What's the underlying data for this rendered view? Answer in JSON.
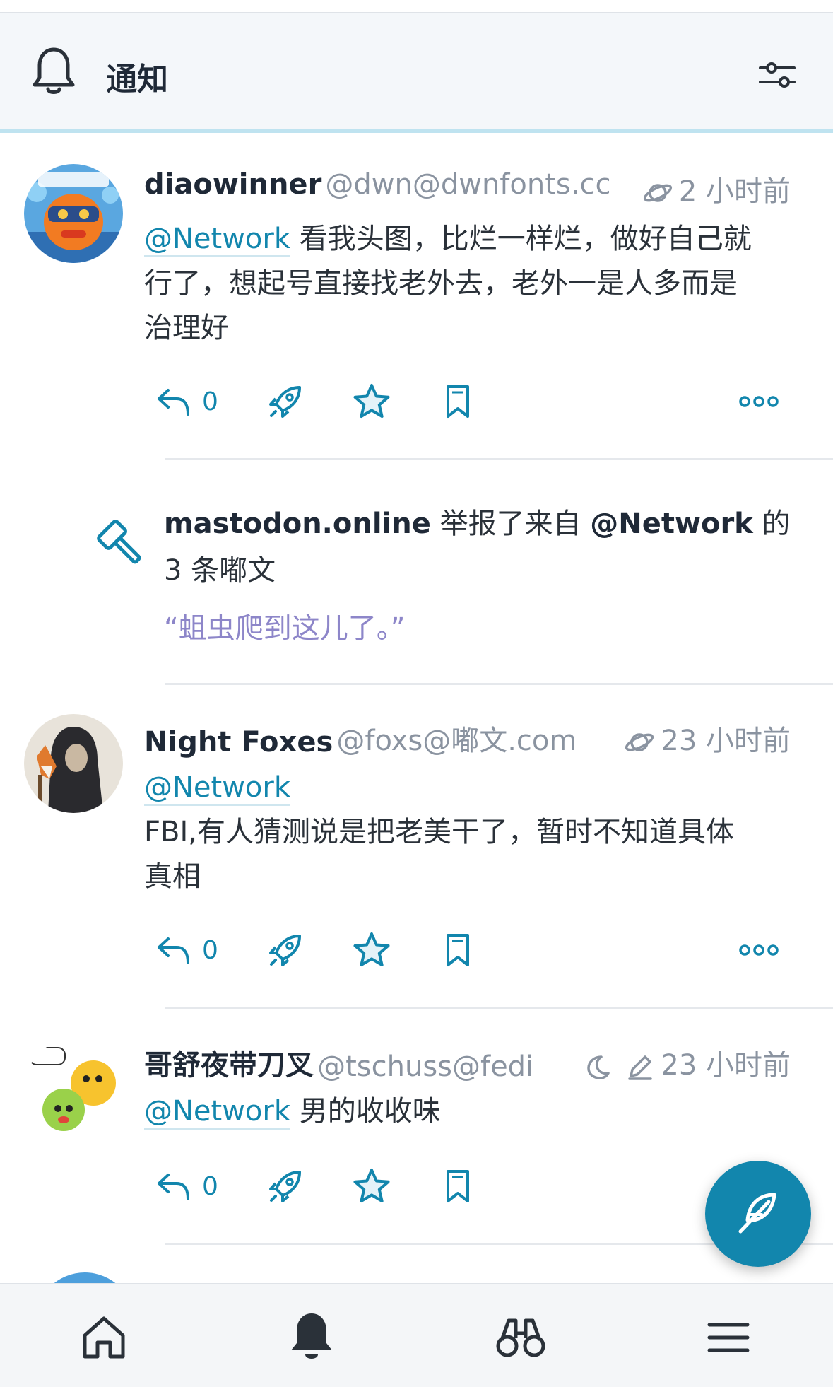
{
  "header": {
    "title": "通知"
  },
  "notifications": [
    {
      "name": "diaowinner",
      "handle": "@dwn@dwnfonts.cc",
      "time": "2 小时前",
      "mention": "@Network",
      "text_line1": "看我头图，比烂一样烂，做好自己就",
      "text_line2": "行了，想起号直接找老外去，老外一是人多而是",
      "text_line3": "治理好",
      "reply_count": "0",
      "visibility_icon": "planet-icon"
    },
    {
      "name": "Night Foxes",
      "handle": "@foxs@嘟文.com",
      "time": "23 小时前",
      "mention": "@Network",
      "text_line1": "FBI,有人猜测说是把老美干了，暂时不知道具体",
      "text_line2": "真相",
      "reply_count": "0",
      "visibility_icon": "planet-icon"
    },
    {
      "name": "哥舒夜带刀叉",
      "handle": "@tschuss@fedi",
      "time": "23 小时前",
      "mention": "@Network",
      "text_line1": "男的收收味",
      "reply_count": "0",
      "visibility_icon": "moon-icon"
    }
  ],
  "report": {
    "instance": "mastodon.online",
    "action": "举报了来自",
    "account": "@Network",
    "suffix": "的",
    "count_text": "3 条嘟文",
    "quote": "“蛆虫爬到这儿了。”"
  },
  "colors": {
    "accent": "#1286ad",
    "muted": "#8a93a0",
    "quote": "#8d86c9",
    "header_bg": "#f4f7fa"
  },
  "tabbar": {
    "items": [
      "home-icon",
      "bell-icon",
      "binoculars-icon",
      "menu-icon"
    ]
  }
}
